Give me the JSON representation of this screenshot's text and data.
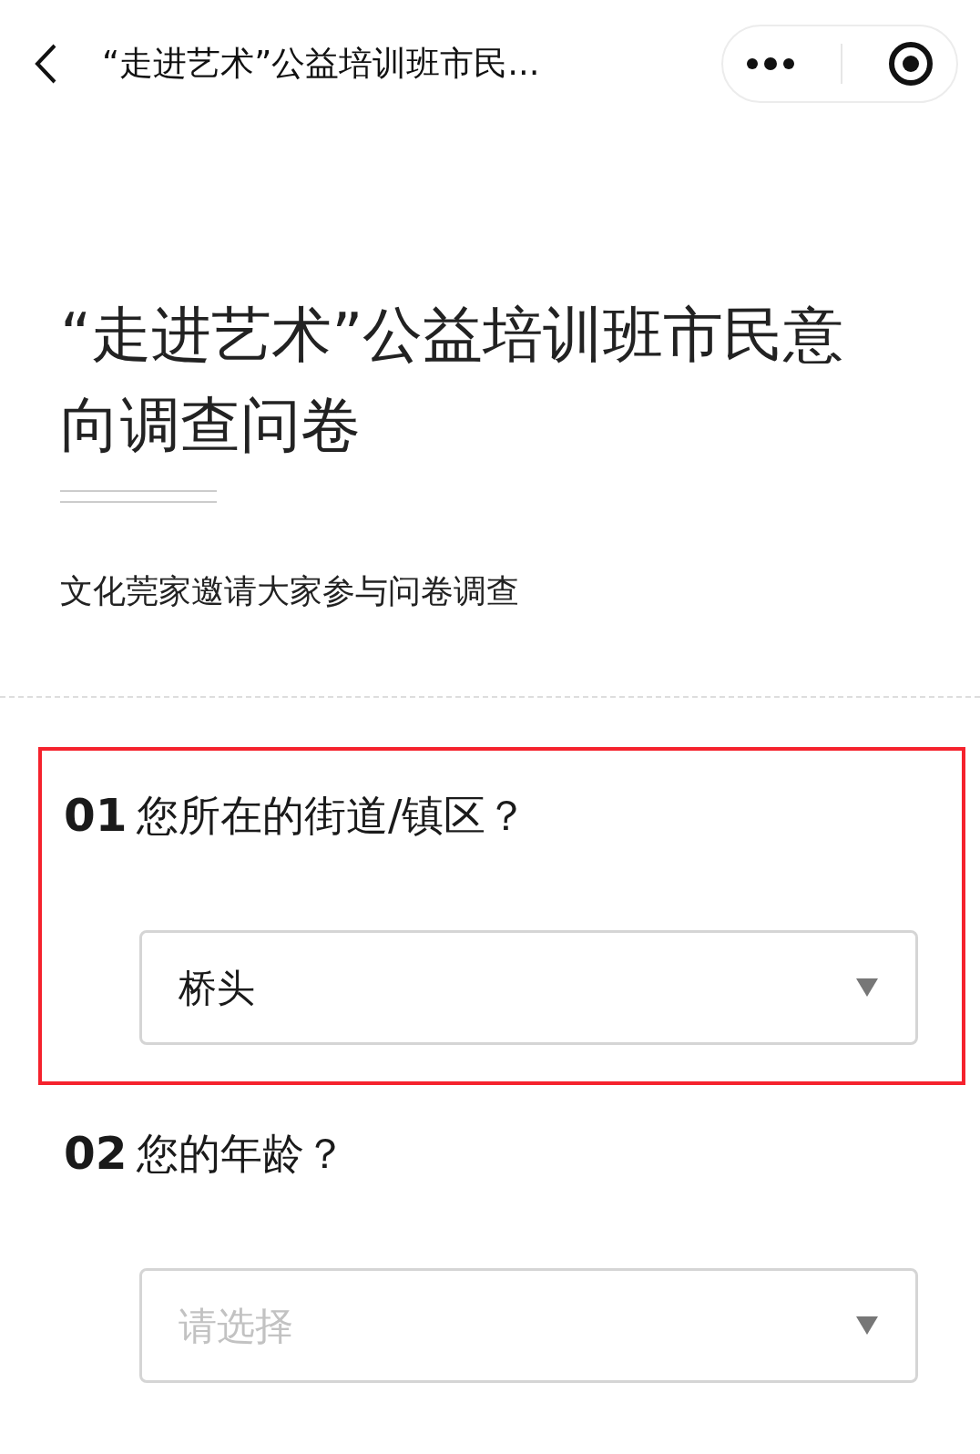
{
  "header": {
    "title": "“走进艺术”公益培训班市民..."
  },
  "survey": {
    "title": "“走进艺术”公益培训班市民意向调查问卷",
    "description": "文化莞家邀请大家参与问卷调查"
  },
  "questions": [
    {
      "number": "01",
      "text": "您所在的街道/镇区？",
      "value": "桥头",
      "highlighted": true
    },
    {
      "number": "02",
      "text": "您的年龄？",
      "placeholder": "请选择",
      "highlighted": false
    }
  ]
}
